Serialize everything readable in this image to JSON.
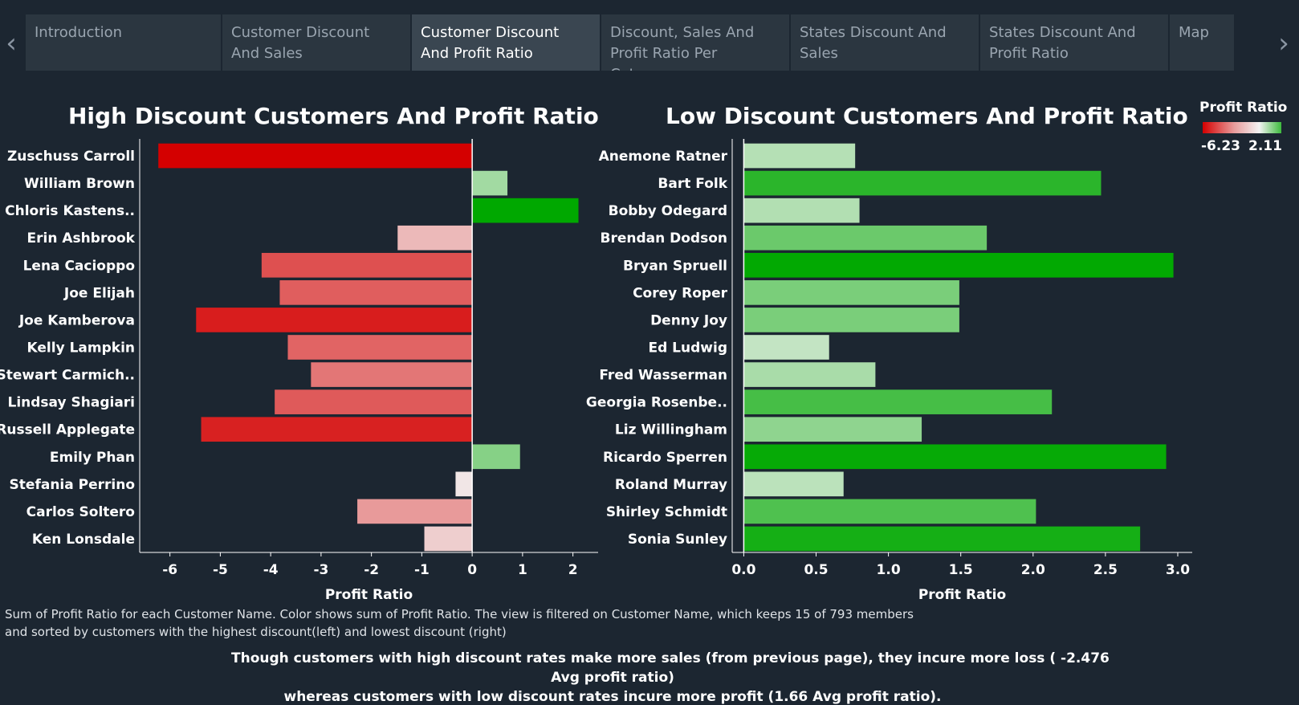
{
  "nav": {
    "prev_icon": "chevron-left-icon",
    "next_icon": "chevron-right-icon",
    "prev_glyph": "‹",
    "next_glyph": "›",
    "tabs": [
      {
        "label": "Introduction",
        "active": false
      },
      {
        "label": "Customer Discount And Sales",
        "active": false
      },
      {
        "label": "Customer Discount And Profit Ratio",
        "active": true
      },
      {
        "label": "Discount, Sales And Profit Ratio Per Category",
        "active": false
      },
      {
        "label": "States Discount And Sales",
        "active": false
      },
      {
        "label": "States Discount And Profit Ratio",
        "active": false
      },
      {
        "label": "Map",
        "active": false
      }
    ]
  },
  "legend": {
    "title": "Profit Ratio",
    "min_label": "-6.23",
    "max_label": "2.11"
  },
  "caption": {
    "line1": "Sum of Profit Ratio for each Customer Name.  Color shows sum of Profit Ratio. The view is filtered on Customer Name, which keeps 15 of 793 members",
    "line2": "and sorted by customers with the highest discount(left) and lowest discount (right)"
  },
  "insight": {
    "line1": "Though customers with high discount rates make more sales (from previous page), they incure more loss ( -2.476",
    "line2": "Avg profit ratio)",
    "line3": "whereas customers with low discount rates incure more profit (1.66 Avg profit ratio)."
  },
  "colors": {
    "background": "#1c2631",
    "negative": "#d40000",
    "neutral": "#f3f3f3",
    "positive": "#00a800",
    "axis": "#ffffff"
  },
  "chart_data": [
    {
      "type": "bar",
      "orientation": "horizontal",
      "title": "High Discount Customers And Profit Ratio",
      "xlabel": "Profit Ratio",
      "ylabel": "",
      "xlim": [
        -6.6,
        2.5
      ],
      "xticks": [
        -6,
        -5,
        -4,
        -3,
        -2,
        -1,
        0,
        1,
        2
      ],
      "xtick_labels": [
        "-6",
        "-5",
        "-4",
        "-3",
        "-2",
        "-1",
        "0",
        "1",
        "2"
      ],
      "categories": [
        "Zuschuss Carroll",
        "William Brown",
        "Chloris Kastens..",
        "Erin Ashbrook",
        "Lena Cacioppo",
        "Joe Elijah",
        "Joe Kamberova",
        "Kelly Lampkin",
        "Stewart Carmich..",
        "Lindsay Shagiari",
        "Russell Applegate",
        "Emily Phan",
        "Stefania Perrino",
        "Carlos Soltero",
        "Ken Lonsdale"
      ],
      "values": [
        -6.23,
        0.7,
        2.11,
        -1.48,
        -4.18,
        -3.82,
        -5.48,
        -3.66,
        -3.2,
        -3.92,
        -5.38,
        0.95,
        -0.33,
        -2.28,
        -0.95
      ],
      "grid": false,
      "legend": "right"
    },
    {
      "type": "bar",
      "orientation": "horizontal",
      "title": "Low Discount Customers And Profit Ratio",
      "xlabel": "Profit Ratio",
      "ylabel": "",
      "xlim": [
        -0.08,
        3.1
      ],
      "xticks": [
        0,
        0.5,
        1.0,
        1.5,
        2.0,
        2.5,
        3.0
      ],
      "xtick_labels": [
        "0.0",
        "0.5",
        "1.0",
        "1.5",
        "2.0",
        "2.5",
        "3.0"
      ],
      "categories": [
        "Anemone Ratner",
        "Bart Folk",
        "Bobby Odegard",
        "Brendan Dodson",
        "Bryan Spruell",
        "Corey Roper",
        "Denny Joy",
        "Ed Ludwig",
        "Fred Wasserman",
        "Georgia Rosenbe..",
        "Liz Willingham",
        "Ricardo Sperren",
        "Roland Murray",
        "Shirley Schmidt",
        "Sonia Sunley"
      ],
      "values": [
        0.77,
        2.47,
        0.8,
        1.68,
        2.97,
        1.49,
        1.49,
        0.59,
        0.91,
        2.13,
        1.23,
        2.92,
        0.69,
        2.02,
        2.74
      ],
      "grid": false,
      "legend": "right"
    }
  ]
}
